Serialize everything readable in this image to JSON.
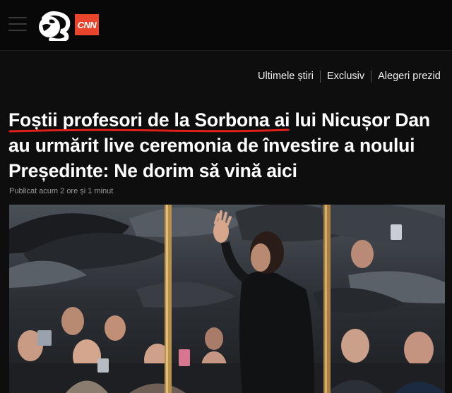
{
  "brand": {
    "logo_icon": "antena3-logo-icon",
    "partner_badge": "CNN",
    "accent_color": "#e8452c"
  },
  "nav": {
    "items": [
      "Ultimele știri",
      "Exclusiv",
      "Alegeri prezid"
    ]
  },
  "article": {
    "title": "Foștii profesori de la Sorbona ai lui Nicușor Dan au urmărit live ceremonia de învestire a noului Președinte: Ne dorim să vină aici",
    "underline_color": "#e0201b",
    "published": "Publicat acum 2 ore și 1 minut",
    "image_icon": "news-photo-icon"
  }
}
